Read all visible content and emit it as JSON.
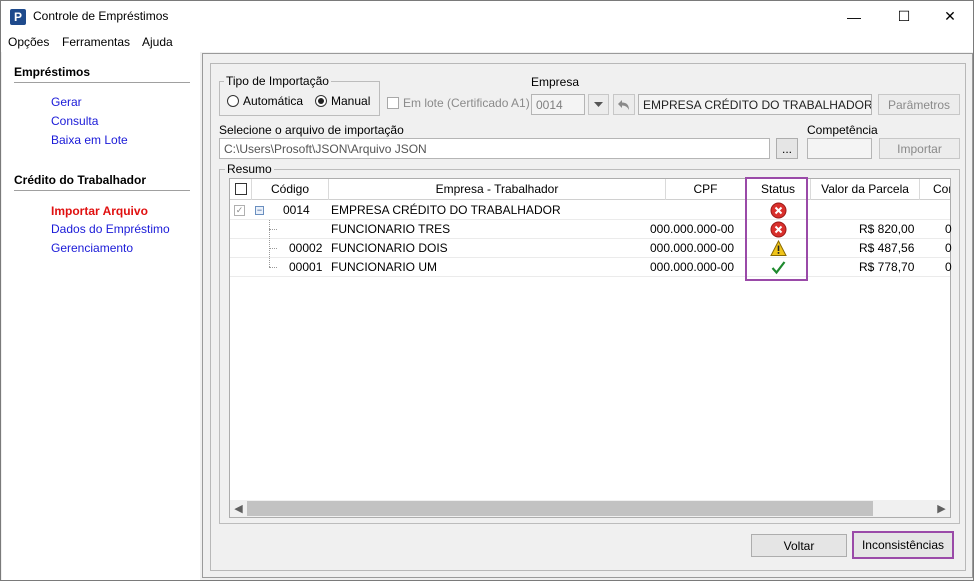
{
  "window": {
    "title": "Controle de Empréstimos",
    "minimize_glyph": "—",
    "maximize_glyph": "☐",
    "close_glyph": "✕"
  },
  "menu": [
    {
      "label": "Opções"
    },
    {
      "label": "Ferramentas"
    },
    {
      "label": "Ajuda"
    }
  ],
  "sidebar": {
    "sections": [
      {
        "title": "Empréstimos",
        "items": [
          "Gerar",
          "Consulta",
          "Baixa em Lote"
        ]
      },
      {
        "title": "Crédito do Trabalhador",
        "items": [
          "Importar Arquivo",
          "Dados do Empréstimo",
          "Gerenciamento"
        ]
      }
    ],
    "active_item": "Importar Arquivo"
  },
  "import_type": {
    "legend": "Tipo de Importação",
    "options": [
      "Automática",
      "Manual"
    ],
    "selected": "Manual"
  },
  "em_lote": {
    "label": "Em lote (Certificado A1)",
    "checked": false
  },
  "empresa": {
    "label": "Empresa",
    "code": "0014",
    "name": "EMPRESA CRÉDITO DO TRABALHADOR",
    "parametros_label": "Parâmetros"
  },
  "arquivo": {
    "label": "Selecione o arquivo de importação",
    "path": "C:\\Users\\Prosoft\\JSON\\Arquivo JSON",
    "browse_label": "..."
  },
  "competencia": {
    "label": "Competência",
    "value": ""
  },
  "importar_label": "Importar",
  "resumo": {
    "legend": "Resumo",
    "columns": [
      "Código",
      "Empresa - Trabalhador",
      "CPF",
      "Status",
      "Valor da Parcela",
      "Cor"
    ],
    "rows": [
      {
        "codigo": "0014",
        "nome": "EMPRESA CRÉDITO DO TRABALHADOR",
        "cpf": "",
        "status": "error",
        "valor": "",
        "extra": ""
      },
      {
        "codigo": "",
        "nome": "FUNCIONARIO TRES",
        "cpf": "000.000.000-00",
        "status": "error",
        "valor": "R$ 820,00",
        "extra": "0"
      },
      {
        "codigo": "00002",
        "nome": "FUNCIONARIO DOIS",
        "cpf": "000.000.000-00",
        "status": "warning",
        "valor": "R$ 487,56",
        "extra": "0"
      },
      {
        "codigo": "00001",
        "nome": "FUNCIONARIO UM",
        "cpf": "000.000.000-00",
        "status": "ok",
        "valor": "R$ 778,70",
        "extra": "0"
      }
    ]
  },
  "buttons": {
    "voltar": "Voltar",
    "inconsistencias": "Inconsistências"
  },
  "colors": {
    "link": "#1a1ad8",
    "active_link": "#e01010",
    "highlight": "#9a4aa8",
    "error": "#d9302c",
    "warning": "#f0c419",
    "ok": "#1e8a2e"
  }
}
